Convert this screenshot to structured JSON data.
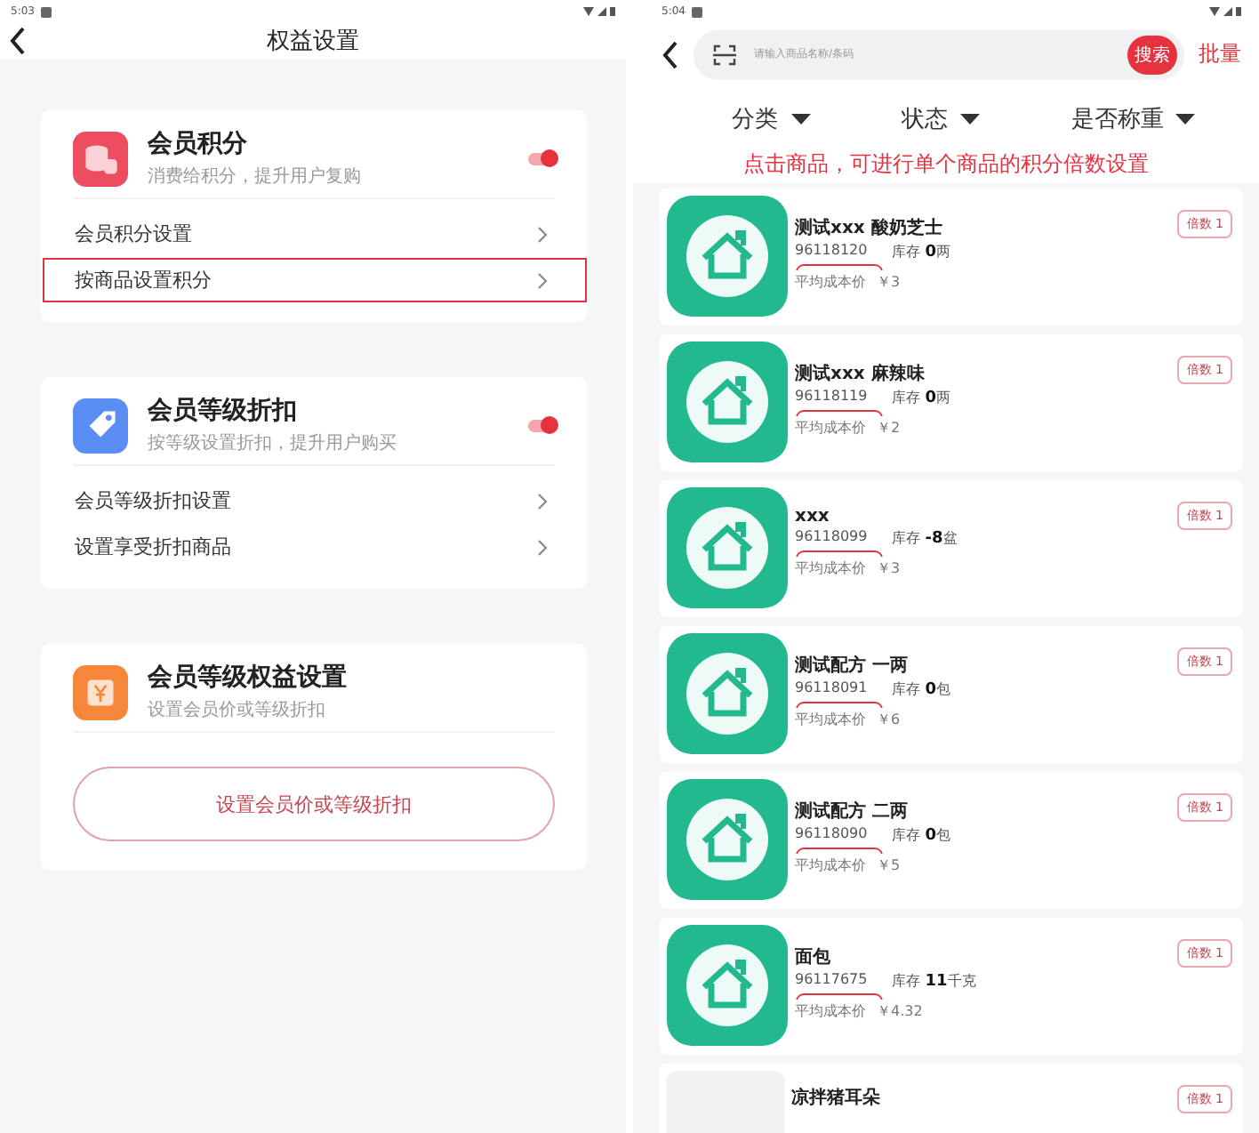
{
  "left": {
    "status_time": "5:03",
    "title": "权益设置",
    "sections": [
      {
        "kind": "toggle",
        "title": "会员积分",
        "subtitle": "消费给积分，提升用户复购",
        "on": true,
        "rows": [
          {
            "label": "会员积分设置",
            "selected": false
          },
          {
            "label": "按商品设置积分",
            "selected": true
          }
        ]
      },
      {
        "kind": "toggle",
        "title": "会员等级折扣",
        "subtitle": "按等级设置折扣，提升用户购买",
        "on": true,
        "rows": [
          {
            "label": "会员等级折扣设置",
            "selected": false
          },
          {
            "label": "设置享受折扣商品",
            "selected": false
          }
        ]
      },
      {
        "kind": "action",
        "title": "会员等级权益设置",
        "subtitle": "设置会员价或等级折扣",
        "button": "设置会员价或等级折扣"
      }
    ]
  },
  "right": {
    "status_time": "5:04",
    "search": {
      "placeholder": "请输入商品名称/条码",
      "button": "搜索"
    },
    "batch": "批量",
    "filters": [
      "分类",
      "状态",
      "是否称重"
    ],
    "hint": "点击商品，可进行单个商品的积分倍数设置",
    "products": [
      {
        "name": "测试xxx 酸奶芝士",
        "code": "96118120",
        "stock": "库存 **0**两",
        "cost_label": "平均成本价",
        "cost": "￥3",
        "badge": "倍数 1"
      },
      {
        "name": "测试xxx 麻辣味",
        "code": "96118119",
        "stock": "库存 **0**两",
        "cost_label": "平均成本价",
        "cost": "￥2",
        "badge": "倍数 1"
      },
      {
        "name": "xxx",
        "code": "96118099",
        "stock": "库存 **-8**盆",
        "cost_label": "平均成本价",
        "cost": "￥3",
        "badge": "倍数 1"
      },
      {
        "name": "测试配方 一两",
        "code": "96118091",
        "stock": "库存 **0**包",
        "cost_label": "平均成本价",
        "cost": "￥6",
        "badge": "倍数 1"
      },
      {
        "name": "测试配方 二两",
        "code": "96118090",
        "stock": "库存 **0**包",
        "cost_label": "平均成本价",
        "cost": "￥5",
        "badge": "倍数 1"
      },
      {
        "name": "面包",
        "code": "96117675",
        "stock": "库存 **11**千克",
        "cost_label": "平均成本价",
        "cost": "￥4.32",
        "badge": "倍数 1"
      },
      {
        "kind": "blank",
        "name": "凉拌猪耳朵",
        "badge": "倍数 1"
      }
    ]
  }
}
